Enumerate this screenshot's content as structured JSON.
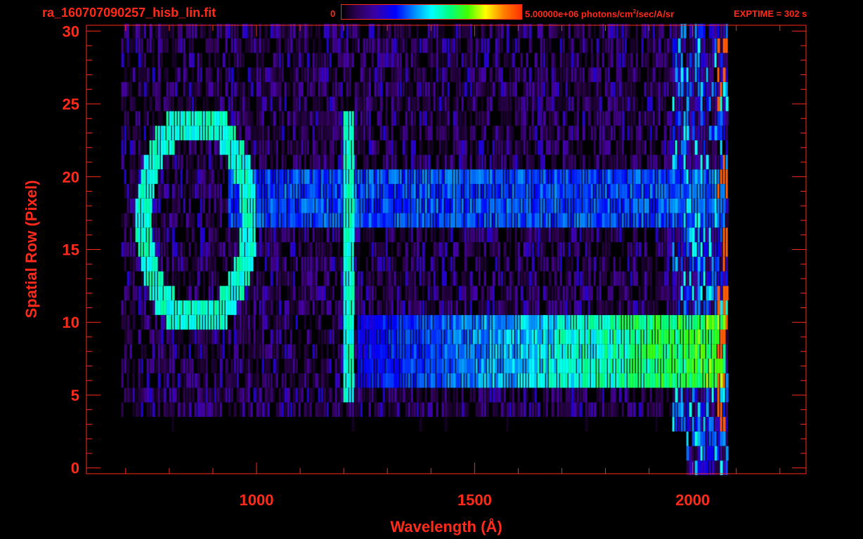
{
  "header": {
    "filename": "ra_160707090257_hisb_lin.fit",
    "colorbar_min": "0",
    "colorbar_max_prefix": "5.00000e+06 photons/cm",
    "colorbar_max_sup": "2",
    "colorbar_max_suffix": "/sec/A/sr",
    "exptime": "EXPTIME = 302 s"
  },
  "colors": {
    "axis": "#ff2a1a",
    "background": "#000000"
  },
  "chart_data": {
    "type": "heatmap",
    "xlabel": "Wavelength (Å)",
    "ylabel": "Spatial Row (Pixel)",
    "xlim": [
      610,
      2260
    ],
    "ylim": [
      -0.4,
      30.4
    ],
    "x_ticks": [
      1000,
      1500,
      2000
    ],
    "y_ticks": [
      0,
      5,
      10,
      15,
      20,
      25,
      30
    ],
    "x_minor_step": 100,
    "y_minor_step": 1,
    "colormap": "rainbow",
    "colorbar_range": [
      0,
      5000000
    ],
    "grid": false,
    "features": [
      {
        "name": "ring",
        "center_x": 860,
        "center_y": 17,
        "radius_x": 120,
        "radius_y": 7,
        "level": 0.6
      },
      {
        "name": "vertical-line",
        "x": 1208,
        "y_range": [
          5,
          24
        ],
        "level": 0.6
      },
      {
        "name": "band-upper",
        "x_range": [
          930,
          2070
        ],
        "y_range": [
          17,
          20
        ],
        "level": 0.45
      },
      {
        "name": "band-lower",
        "x_range": [
          1230,
          2070
        ],
        "y_range": [
          6,
          10
        ],
        "level": 0.55
      }
    ],
    "data_extent": {
      "x_range": [
        690,
        2080
      ],
      "y_range": [
        0,
        30
      ]
    }
  }
}
